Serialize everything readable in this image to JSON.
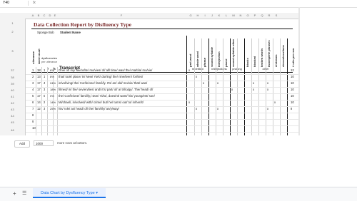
{
  "namebox": "Y40",
  "fx": "fx",
  "columns": [
    "A",
    "B",
    "C",
    "D",
    "E",
    "F",
    "G",
    "H",
    "I",
    "J",
    "K",
    "L",
    "M",
    "N",
    "O",
    "P",
    "Q",
    "R",
    "S"
  ],
  "title": "Data Collection Report by Disfluency Type",
  "student": {
    "name": "Sponge Bob",
    "label": "Student Name"
  },
  "hdr": {
    "utterance": "utterance",
    "word_count": "word count",
    "disfluencies": "dysfluencies",
    "per_utterance": "per utterance",
    "num": "#",
    "pct": "%",
    "transcript": "Transcript",
    "utt_short": "utt #"
  },
  "types": [
    "part-word",
    "whole word",
    "phrase",
    "sound-syllable",
    "interjection",
    "pause",
    "sound-syllable other",
    "blocks",
    "blocked",
    "broken words",
    "incomplete phrases",
    "revisions",
    "circumlocutions",
    "# utts per row"
  ],
  "groups": [
    "repetition",
    "interjections",
    "prolong",
    "other"
  ],
  "row_numbers": [
    "1",
    "2",
    "3",
    "37",
    "38",
    "39",
    "40",
    "41",
    "42",
    "43",
    "44",
    "45",
    "46"
  ],
  "rows": [
    {
      "n": "1",
      "wc": "18",
      "d": "1",
      "pct": "6%",
      "t": "One/ of/ my/ fav/or/ite/ mo/vies/ of/ all/ time/ was/ the/ ma/ti/a/ mo/vie/",
      "marks": [
        "x",
        "",
        "",
        "",
        "",
        "",
        "",
        "",
        "",
        "",
        "",
        "",
        "",
        ""
      ],
      "total": "12"
    },
    {
      "n": "2",
      "wc": "13",
      "d": "1",
      "pct": "8%",
      "t": "that/ took/ place/ in/ New/ York/ dur/ing/ the/ nine/teen/ for/ties/",
      "marks": [
        "",
        "x",
        "",
        "",
        "",
        "",
        "",
        "",
        "",
        "",
        "",
        "",
        "",
        ""
      ],
      "total": "10"
    },
    {
      "n": "3",
      "wc": "17",
      "d": "4",
      "pct": "24%",
      "t": "in/vol/ving/ the/ Cor/le/one/ fam/i/ly. It's/ an/ old/ mo/vie/ that/ was/",
      "marks": [
        "",
        "",
        "x",
        "",
        "x",
        "",
        "",
        "",
        "x",
        "",
        "x",
        "",
        "",
        ""
      ],
      "total": "10"
    },
    {
      "n": "4",
      "wc": "17",
      "d": "3",
      "pct": "18%",
      "t": "filmed/ in/ the/ sev/en/ties/ and/ it's/ part/ of/ a/ tril/o/gy/. The/ head/ of/",
      "marks": [
        "",
        "",
        "",
        "",
        "",
        "",
        "x",
        "",
        "x",
        "",
        "x",
        "",
        "",
        ""
      ],
      "total": "10"
    },
    {
      "n": "5",
      "wc": "17",
      "d": "0",
      "pct": "0%",
      "t": "the/ Cor/le/one/ fam/i/ly,/ Don/ Vi/to/, does/nt/ want/ his/ young/est/ son/",
      "marks": [
        "",
        "",
        "",
        "",
        "",
        "",
        "",
        "",
        "",
        "",
        "",
        "",
        "",
        ""
      ],
      "total": "10"
    },
    {
      "n": "6",
      "wc": "14",
      "d": "2",
      "pct": "14%",
      "t": "Mi/chael/, in/volved/ with/ crime/ but/ he/ turns/ out/ to/ in/her/it/",
      "marks": [
        "x",
        "",
        "",
        "",
        "",
        "",
        "",
        "",
        "",
        "",
        "",
        "x",
        "",
        ""
      ],
      "total": "10"
    },
    {
      "n": "7",
      "wc": "12",
      "d": "3",
      "pct": "25%",
      "t": "his/ role/ as/ head/ of/ the/ fam/i/ly/ an/y/way/",
      "marks": [
        "",
        "x",
        "",
        "",
        "x",
        "",
        "",
        "",
        "",
        "",
        "x",
        "",
        "",
        ""
      ],
      "total": "8"
    },
    {
      "n": "8",
      "wc": "",
      "d": "",
      "pct": "",
      "t": "",
      "marks": [
        "",
        "",
        "",
        "",
        "",
        "",
        "",
        "",
        "",
        "",
        "",
        "",
        "",
        ""
      ],
      "total": ""
    },
    {
      "n": "9",
      "wc": "",
      "d": "",
      "pct": "",
      "t": "",
      "marks": [
        "",
        "",
        "",
        "",
        "",
        "",
        "",
        "",
        "",
        "",
        "",
        "",
        "",
        ""
      ],
      "total": ""
    },
    {
      "n": "10",
      "wc": "",
      "d": "",
      "pct": "",
      "t": "",
      "marks": [
        "",
        "",
        "",
        "",
        "",
        "",
        "",
        "",
        "",
        "",
        "",
        "",
        "",
        ""
      ],
      "total": ""
    }
  ],
  "footer": {
    "add_label": "Add",
    "rows_value": "1000",
    "more_text": "more rows at bottom."
  },
  "sheet_tab": "Data Chart by Dysfluency Type ▾",
  "colors": {
    "title": "#7a2a2a",
    "tab": "#1a73e8",
    "header_bg": "#f3f3f3"
  }
}
